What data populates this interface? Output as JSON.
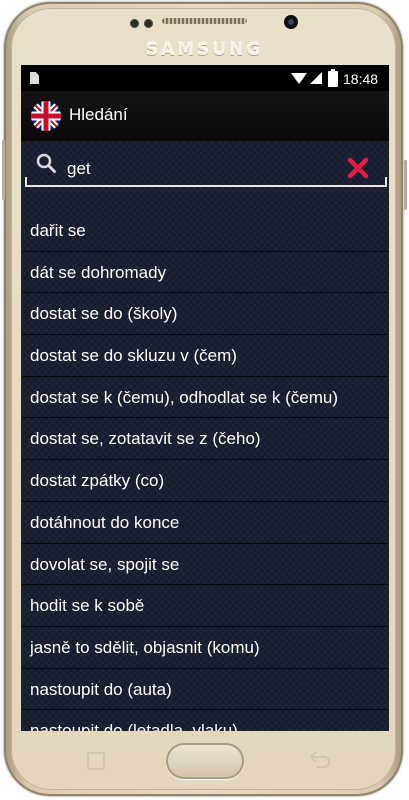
{
  "device": {
    "brand": "SAMSUNG"
  },
  "status_bar": {
    "time": "18:48",
    "icons": [
      "sim-card-icon",
      "wifi-icon",
      "signal-icon",
      "battery-icon"
    ]
  },
  "app_bar": {
    "title": "Hledání",
    "flag_icon": "uk-flag-icon"
  },
  "search": {
    "value": "get",
    "search_icon": "magnifier-icon",
    "clear_icon": "clear-x-icon",
    "clear_color": "#e11d48"
  },
  "results": [
    "dařit se",
    "dát se dohromady",
    "dostat se do (školy)",
    "dostat se do skluzu v (čem)",
    "dostat se k (čemu), odhodlat se k (čemu)",
    "dostat se, zotatavit se z (čeho)",
    "dostat zpátky (co)",
    "dotáhnout do konce",
    "dovolat se, spojit se",
    "hodit se k sobě",
    "jasně to sdělit, objasnit (komu)",
    "nastoupit do (auta)",
    "nastoupit do (letadla, vlaku)"
  ],
  "colors": {
    "screen_bg": "#161c2c",
    "text": "#ffffff",
    "frame": "#e2d7bd"
  }
}
